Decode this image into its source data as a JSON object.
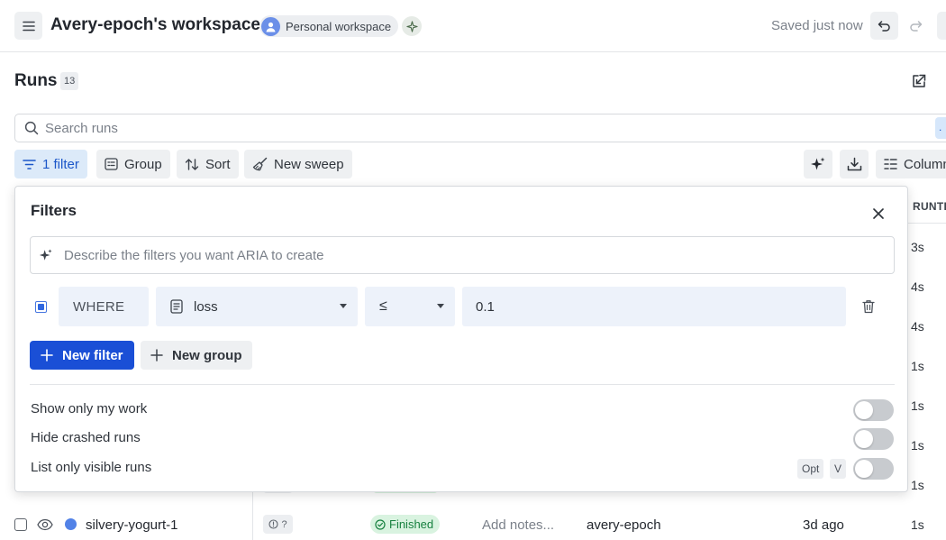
{
  "topbar": {
    "workspace_title": "Avery-epoch's workspace",
    "workspace_badge": "Personal workspace",
    "saved_status": "Saved just now"
  },
  "runs": {
    "title": "Runs",
    "count": "13",
    "search_placeholder": "Search runs",
    "search_end_chip": "."
  },
  "toolbar": {
    "filter_label": "1 filter",
    "group_label": "Group",
    "sort_label": "Sort",
    "sweep_label": "New sweep",
    "columns_label": "Columns"
  },
  "table": {
    "runtime_header": "RUNTIME",
    "runtime_values": [
      "3s",
      "4s",
      "4s",
      "1s",
      "1s",
      "1s",
      "1s"
    ],
    "visible_row": {
      "name": "silvery-yogurt-1",
      "state_badge": "?",
      "status": "Finished",
      "notes_placeholder": "Add notes...",
      "user": "avery-epoch",
      "created": "3d ago",
      "runtime": "1s"
    }
  },
  "filters_panel": {
    "title": "Filters",
    "aria_placeholder": "Describe the filters you want ARIA to create",
    "filter_row": {
      "enabled": true,
      "where_label": "WHERE",
      "field": "loss",
      "operator": "≤",
      "value": "0.1"
    },
    "new_filter_label": "New filter",
    "new_group_label": "New group",
    "options": [
      {
        "label": "Show only my work",
        "on": false
      },
      {
        "label": "Hide crashed runs",
        "on": false
      },
      {
        "label": "List only visible runs",
        "on": false
      }
    ],
    "shortcut_keys": [
      "Opt",
      "V"
    ]
  },
  "colors": {
    "accent_blue": "#1a4fd6",
    "active_filter_bg": "#dceaf9",
    "finished_green": "#17803f",
    "run_dot": "#5282e7"
  }
}
